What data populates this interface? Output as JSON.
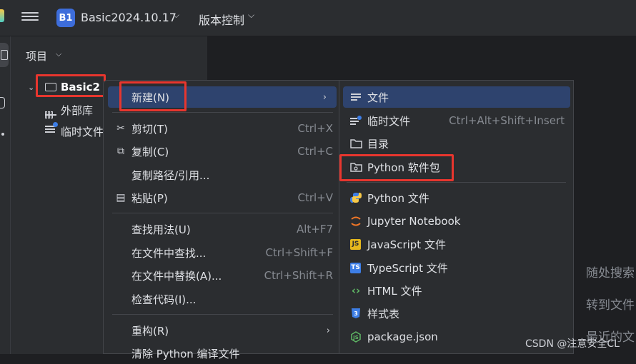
{
  "titlebar": {
    "project_badge": "B1",
    "project_name": "Basic2024.10.17",
    "vcs_label": "版本控制",
    "chevron": "⌵"
  },
  "panel": {
    "title": "项目",
    "tree": {
      "root": "Basic2",
      "external_libs": "外部库",
      "scratches": "临时文件"
    }
  },
  "context_menu": {
    "items": [
      {
        "label": "新建(N)",
        "shortcut": "",
        "icon": "",
        "has_submenu": true
      },
      {
        "label": "剪切(T)",
        "shortcut": "Ctrl+X",
        "icon": "scissors-icon"
      },
      {
        "label": "复制(C)",
        "shortcut": "Ctrl+C",
        "icon": "copy-icon"
      },
      {
        "label": "复制路径/引用...",
        "shortcut": "",
        "icon": ""
      },
      {
        "label": "粘贴(P)",
        "shortcut": "Ctrl+V",
        "icon": "paste-icon"
      },
      {
        "label": "查找用法(U)",
        "shortcut": "Alt+F7",
        "icon": ""
      },
      {
        "label": "在文件中查找...",
        "shortcut": "Ctrl+Shift+F",
        "icon": ""
      },
      {
        "label": "在文件中替换(A)...",
        "shortcut": "Ctrl+Shift+R",
        "icon": ""
      },
      {
        "label": "检查代码(I)...",
        "shortcut": "",
        "icon": ""
      },
      {
        "label": "重构(R)",
        "shortcut": "",
        "icon": "",
        "has_submenu": true
      },
      {
        "label": "清除 Python 编译文件",
        "shortcut": "",
        "icon": ""
      }
    ]
  },
  "submenu": {
    "items": [
      {
        "label": "文件",
        "shortcut": "",
        "icon": "file-lines-icon"
      },
      {
        "label": "临时文件",
        "shortcut": "Ctrl+Alt+Shift+Insert",
        "icon": "scratch-file-icon"
      },
      {
        "label": "目录",
        "shortcut": "",
        "icon": "folder-icon"
      },
      {
        "label": "Python 软件包",
        "shortcut": "",
        "icon": "python-package-icon"
      },
      {
        "label": "Python 文件",
        "shortcut": "",
        "icon": "python-icon"
      },
      {
        "label": "Jupyter Notebook",
        "shortcut": "",
        "icon": "jupyter-icon"
      },
      {
        "label": "JavaScript 文件",
        "shortcut": "",
        "icon": "javascript-icon"
      },
      {
        "label": "TypeScript 文件",
        "shortcut": "",
        "icon": "typescript-icon"
      },
      {
        "label": "HTML 文件",
        "shortcut": "",
        "icon": "html-icon"
      },
      {
        "label": "样式表",
        "shortcut": "",
        "icon": "css-icon"
      },
      {
        "label": "package.json",
        "shortcut": "",
        "icon": "nodejs-icon"
      }
    ]
  },
  "editor_hints": [
    "随处搜索",
    "转到文件",
    "最近的文"
  ],
  "watermark": "CSDN @注意安全CL",
  "colors": {
    "background": "#1e1f22",
    "panel": "#2b2d30",
    "selection": "#2e436e",
    "highlight_box": "#e8362e",
    "badge": "#3d6ddb"
  }
}
